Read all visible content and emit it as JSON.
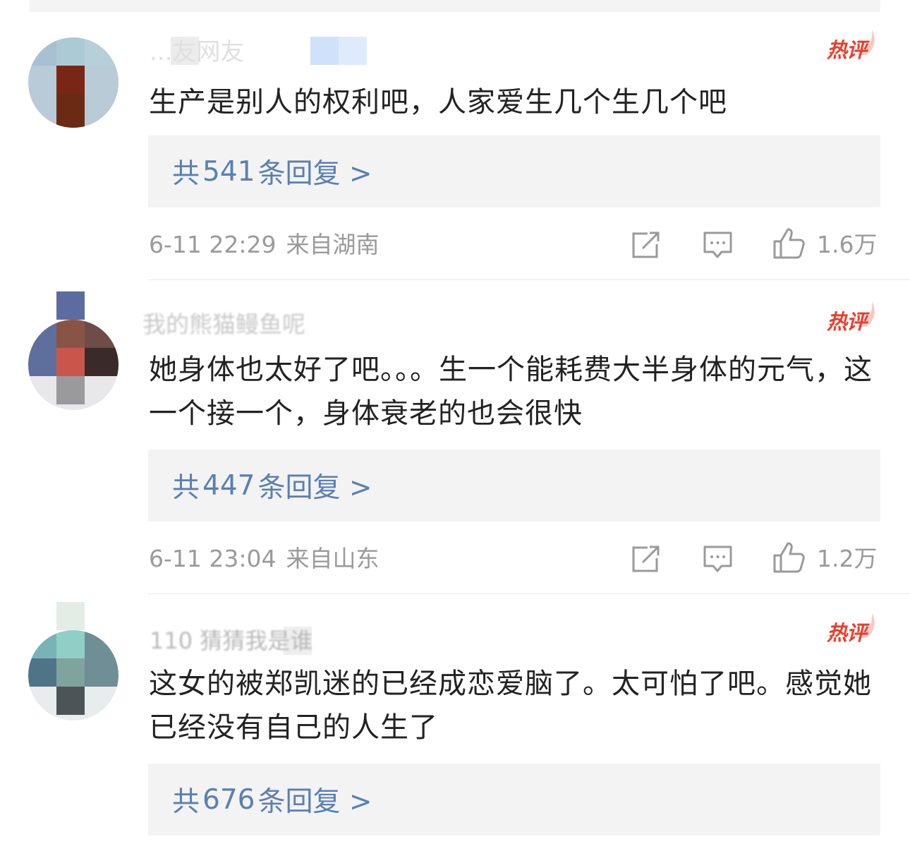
{
  "hot_label": "热评",
  "colors": {
    "link": "#5a7fb3",
    "hot": "#ea3d2c",
    "meta": "#9a9a9a"
  },
  "icons": [
    "repost-icon",
    "comment-icon",
    "like-icon",
    "hot-flame-icon"
  ],
  "comments": [
    {
      "username": "...友网友",
      "text": "生产是别人的权利吧，人家爱生几个生几个吧",
      "reply_prefix": "共",
      "reply_count": "541",
      "reply_suffix": "条回复 >",
      "time": "6-11 22:29",
      "location": "来自湖南",
      "likes": "1.6万"
    },
    {
      "username": "我的熊猫鳗鱼呢",
      "text": "她身体也太好了吧。。。生一个能耗费大半身体的元气，这一个接一个，身体衰老的也会很快",
      "reply_prefix": "共",
      "reply_count": "447",
      "reply_suffix": "条回复 >",
      "time": "6-11 23:04",
      "location": "来自山东",
      "likes": "1.2万"
    },
    {
      "username": "110 猜猜我是谁",
      "text": "这女的被郑凯迷的已经成恋爱脑了。太可怕了吧。感觉她已经没有自己的人生了",
      "reply_prefix": "共",
      "reply_count": "676",
      "reply_suffix": "条回复 >"
    }
  ]
}
